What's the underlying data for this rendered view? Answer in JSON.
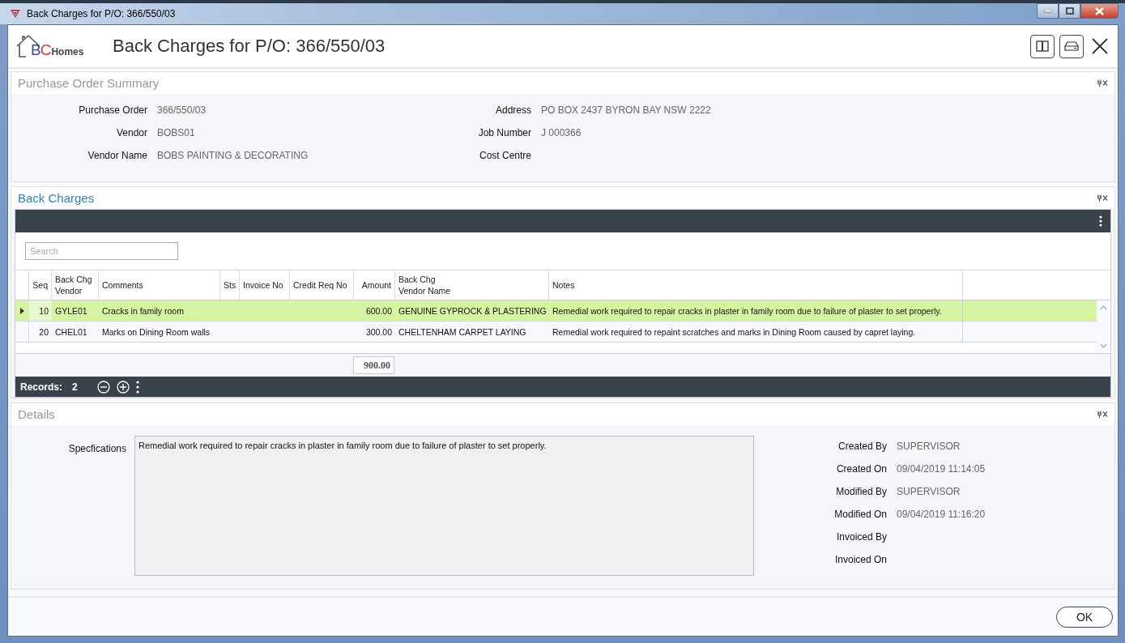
{
  "window": {
    "title": "Back Charges for P/O: 366/550/03"
  },
  "logo": {
    "letters": [
      {
        "text": "B",
        "color": "#3b4a9c"
      },
      {
        "text": "C",
        "color": "#d0353b"
      }
    ],
    "suffix": "Homes"
  },
  "header": {
    "title": "Back Charges for P/O: 366/550/03"
  },
  "summary": {
    "title": "Purchase Order Summary",
    "left": [
      {
        "label": "Purchase Order",
        "value": "366/550/03"
      },
      {
        "label": "Vendor",
        "value": "BOBS01"
      },
      {
        "label": "Vendor Name",
        "value": "BOBS PAINTING & DECORATING"
      }
    ],
    "right": [
      {
        "label": "Address",
        "value": "PO BOX 2437 BYRON BAY NSW 2222"
      },
      {
        "label": "Job Number",
        "value": "J 000366"
      },
      {
        "label": "Cost Centre"
      }
    ]
  },
  "back_charges": {
    "title": "Back Charges",
    "search": {
      "placeholder": "Search"
    },
    "columns": [
      {
        "label": "Seq",
        "kind": "number"
      },
      {
        "label": "Back Chg\nVendor",
        "kind": "text"
      },
      {
        "label": "Comments",
        "kind": "text"
      },
      {
        "label": "Sts",
        "kind": "text"
      },
      {
        "label": "Invoice No",
        "kind": "text"
      },
      {
        "label": "Credit Req No",
        "kind": "text"
      },
      {
        "label": "Amount",
        "kind": "number"
      },
      {
        "label": "Back Chg\nVendor Name",
        "kind": "text"
      },
      {
        "label": "Notes",
        "kind": "text"
      }
    ],
    "rows": [
      {
        "selected": true,
        "cells": [
          "10",
          "GYLE01",
          "Cracks in family room",
          null,
          null,
          null,
          "600.00",
          "GENUINE GYPROCK & PLASTERING",
          "Remedial work required to repair cracks in plaster in family room due to failure of plaster to set properly."
        ]
      },
      {
        "selected": false,
        "cells": [
          "20",
          "CHEL01",
          "Marks on Dining Room walls",
          null,
          null,
          null,
          "300.00",
          "CHELTENHAM CARPET LAYING",
          "Remedial work required to repaint scratches and marks in Dining Room caused by capret laying."
        ]
      }
    ],
    "total": "900.00",
    "records_label": "Records:",
    "records_count": "2"
  },
  "details": {
    "title": "Details",
    "spec_label": "Specfications",
    "spec_value": "Remedial work required to repair cracks in plaster in family room due to failure of plaster to set properly.",
    "meta": [
      {
        "label": "Created By",
        "value": "SUPERVISOR"
      },
      {
        "label": "Created On",
        "value": "09/04/2019  11:14:05"
      },
      {
        "label": "Modified By",
        "value": "SUPERVISOR"
      },
      {
        "label": "Modified On",
        "value": "09/04/2019  11:16:20"
      },
      {
        "label": "Invoiced By"
      },
      {
        "label": "Invoiced On"
      }
    ]
  },
  "footer": {
    "ok": "OK"
  }
}
